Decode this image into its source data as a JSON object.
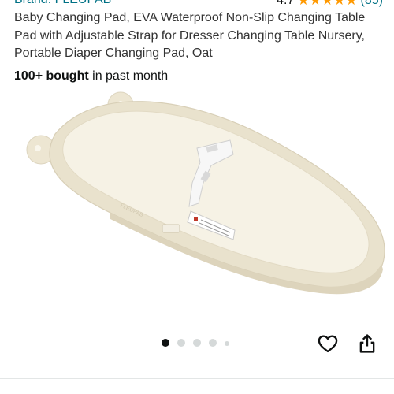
{
  "product": {
    "brand_text": "Brand: FLEUPAB",
    "rating_value": "4.7",
    "rating_stars": "★★★★★",
    "rating_count": "(85)",
    "title": "Baby Changing Pad, EVA Waterproof Non-Slip Changing Table Pad with Adjustable Strap for Dresser Changing Table Nursery, Portable Diaper Changing Pad, Oat",
    "bought_bold": "100+ bought",
    "bought_rest": " in past month",
    "image_alt": "Oat colored baby changing pad with white adjustable strap"
  },
  "carousel": {
    "dots_total": 5,
    "active_index": 0
  },
  "icons": {
    "favorite": "heart-icon",
    "share": "share-icon"
  },
  "colors": {
    "link": "#007185",
    "star": "#ff9900",
    "pad": "#efe9d8"
  }
}
